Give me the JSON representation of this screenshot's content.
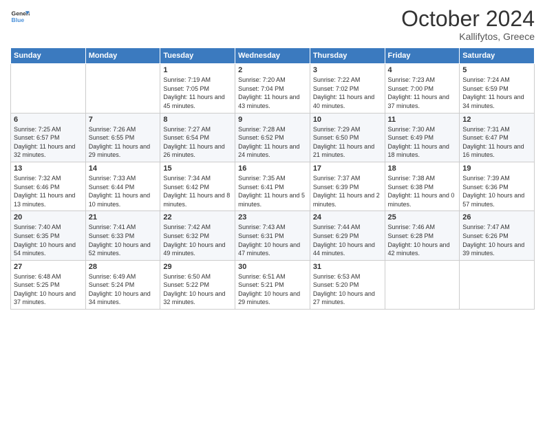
{
  "header": {
    "logo_line1": "General",
    "logo_line2": "Blue",
    "month_title": "October 2024",
    "location": "Kallifytos, Greece"
  },
  "days_of_week": [
    "Sunday",
    "Monday",
    "Tuesday",
    "Wednesday",
    "Thursday",
    "Friday",
    "Saturday"
  ],
  "weeks": [
    [
      {
        "day": "",
        "sunrise": "",
        "sunset": "",
        "daylight": ""
      },
      {
        "day": "",
        "sunrise": "",
        "sunset": "",
        "daylight": ""
      },
      {
        "day": "1",
        "sunrise": "Sunrise: 7:19 AM",
        "sunset": "Sunset: 7:05 PM",
        "daylight": "Daylight: 11 hours and 45 minutes."
      },
      {
        "day": "2",
        "sunrise": "Sunrise: 7:20 AM",
        "sunset": "Sunset: 7:04 PM",
        "daylight": "Daylight: 11 hours and 43 minutes."
      },
      {
        "day": "3",
        "sunrise": "Sunrise: 7:22 AM",
        "sunset": "Sunset: 7:02 PM",
        "daylight": "Daylight: 11 hours and 40 minutes."
      },
      {
        "day": "4",
        "sunrise": "Sunrise: 7:23 AM",
        "sunset": "Sunset: 7:00 PM",
        "daylight": "Daylight: 11 hours and 37 minutes."
      },
      {
        "day": "5",
        "sunrise": "Sunrise: 7:24 AM",
        "sunset": "Sunset: 6:59 PM",
        "daylight": "Daylight: 11 hours and 34 minutes."
      }
    ],
    [
      {
        "day": "6",
        "sunrise": "Sunrise: 7:25 AM",
        "sunset": "Sunset: 6:57 PM",
        "daylight": "Daylight: 11 hours and 32 minutes."
      },
      {
        "day": "7",
        "sunrise": "Sunrise: 7:26 AM",
        "sunset": "Sunset: 6:55 PM",
        "daylight": "Daylight: 11 hours and 29 minutes."
      },
      {
        "day": "8",
        "sunrise": "Sunrise: 7:27 AM",
        "sunset": "Sunset: 6:54 PM",
        "daylight": "Daylight: 11 hours and 26 minutes."
      },
      {
        "day": "9",
        "sunrise": "Sunrise: 7:28 AM",
        "sunset": "Sunset: 6:52 PM",
        "daylight": "Daylight: 11 hours and 24 minutes."
      },
      {
        "day": "10",
        "sunrise": "Sunrise: 7:29 AM",
        "sunset": "Sunset: 6:50 PM",
        "daylight": "Daylight: 11 hours and 21 minutes."
      },
      {
        "day": "11",
        "sunrise": "Sunrise: 7:30 AM",
        "sunset": "Sunset: 6:49 PM",
        "daylight": "Daylight: 11 hours and 18 minutes."
      },
      {
        "day": "12",
        "sunrise": "Sunrise: 7:31 AM",
        "sunset": "Sunset: 6:47 PM",
        "daylight": "Daylight: 11 hours and 16 minutes."
      }
    ],
    [
      {
        "day": "13",
        "sunrise": "Sunrise: 7:32 AM",
        "sunset": "Sunset: 6:46 PM",
        "daylight": "Daylight: 11 hours and 13 minutes."
      },
      {
        "day": "14",
        "sunrise": "Sunrise: 7:33 AM",
        "sunset": "Sunset: 6:44 PM",
        "daylight": "Daylight: 11 hours and 10 minutes."
      },
      {
        "day": "15",
        "sunrise": "Sunrise: 7:34 AM",
        "sunset": "Sunset: 6:42 PM",
        "daylight": "Daylight: 11 hours and 8 minutes."
      },
      {
        "day": "16",
        "sunrise": "Sunrise: 7:35 AM",
        "sunset": "Sunset: 6:41 PM",
        "daylight": "Daylight: 11 hours and 5 minutes."
      },
      {
        "day": "17",
        "sunrise": "Sunrise: 7:37 AM",
        "sunset": "Sunset: 6:39 PM",
        "daylight": "Daylight: 11 hours and 2 minutes."
      },
      {
        "day": "18",
        "sunrise": "Sunrise: 7:38 AM",
        "sunset": "Sunset: 6:38 PM",
        "daylight": "Daylight: 11 hours and 0 minutes."
      },
      {
        "day": "19",
        "sunrise": "Sunrise: 7:39 AM",
        "sunset": "Sunset: 6:36 PM",
        "daylight": "Daylight: 10 hours and 57 minutes."
      }
    ],
    [
      {
        "day": "20",
        "sunrise": "Sunrise: 7:40 AM",
        "sunset": "Sunset: 6:35 PM",
        "daylight": "Daylight: 10 hours and 54 minutes."
      },
      {
        "day": "21",
        "sunrise": "Sunrise: 7:41 AM",
        "sunset": "Sunset: 6:33 PM",
        "daylight": "Daylight: 10 hours and 52 minutes."
      },
      {
        "day": "22",
        "sunrise": "Sunrise: 7:42 AM",
        "sunset": "Sunset: 6:32 PM",
        "daylight": "Daylight: 10 hours and 49 minutes."
      },
      {
        "day": "23",
        "sunrise": "Sunrise: 7:43 AM",
        "sunset": "Sunset: 6:31 PM",
        "daylight": "Daylight: 10 hours and 47 minutes."
      },
      {
        "day": "24",
        "sunrise": "Sunrise: 7:44 AM",
        "sunset": "Sunset: 6:29 PM",
        "daylight": "Daylight: 10 hours and 44 minutes."
      },
      {
        "day": "25",
        "sunrise": "Sunrise: 7:46 AM",
        "sunset": "Sunset: 6:28 PM",
        "daylight": "Daylight: 10 hours and 42 minutes."
      },
      {
        "day": "26",
        "sunrise": "Sunrise: 7:47 AM",
        "sunset": "Sunset: 6:26 PM",
        "daylight": "Daylight: 10 hours and 39 minutes."
      }
    ],
    [
      {
        "day": "27",
        "sunrise": "Sunrise: 6:48 AM",
        "sunset": "Sunset: 5:25 PM",
        "daylight": "Daylight: 10 hours and 37 minutes."
      },
      {
        "day": "28",
        "sunrise": "Sunrise: 6:49 AM",
        "sunset": "Sunset: 5:24 PM",
        "daylight": "Daylight: 10 hours and 34 minutes."
      },
      {
        "day": "29",
        "sunrise": "Sunrise: 6:50 AM",
        "sunset": "Sunset: 5:22 PM",
        "daylight": "Daylight: 10 hours and 32 minutes."
      },
      {
        "day": "30",
        "sunrise": "Sunrise: 6:51 AM",
        "sunset": "Sunset: 5:21 PM",
        "daylight": "Daylight: 10 hours and 29 minutes."
      },
      {
        "day": "31",
        "sunrise": "Sunrise: 6:53 AM",
        "sunset": "Sunset: 5:20 PM",
        "daylight": "Daylight: 10 hours and 27 minutes."
      },
      {
        "day": "",
        "sunrise": "",
        "sunset": "",
        "daylight": ""
      },
      {
        "day": "",
        "sunrise": "",
        "sunset": "",
        "daylight": ""
      }
    ]
  ]
}
